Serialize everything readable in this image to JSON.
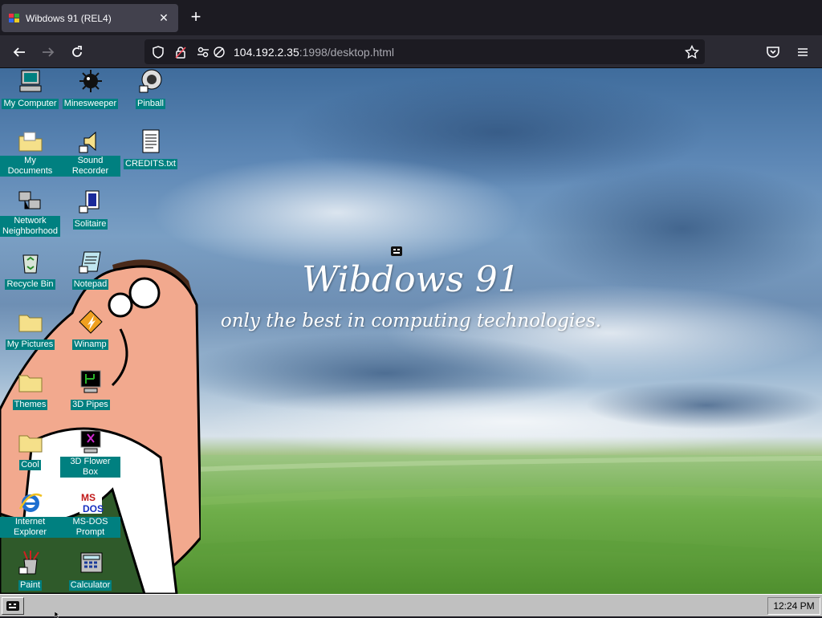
{
  "browser": {
    "tab_title": "Wibdows 91 (REL4)",
    "url_host": "104.192.2.35",
    "url_rest": ":1998/desktop.html"
  },
  "desktop": {
    "title": "Wibdows 91",
    "subtitle": "only the best in computing technologies.",
    "icons": [
      {
        "label": "My Computer",
        "icon": "computer-icon"
      },
      {
        "label": "Minesweeper",
        "icon": "minesweeper-icon"
      },
      {
        "label": "Pinball",
        "icon": "pinball-icon"
      },
      {
        "label": "My Documents",
        "icon": "documents-folder-icon"
      },
      {
        "label": "Sound Recorder",
        "icon": "sound-recorder-icon"
      },
      {
        "label": "CREDITS.txt",
        "icon": "text-file-icon"
      },
      {
        "label": "Network Neighborhood",
        "icon": "network-icon"
      },
      {
        "label": "Solitaire",
        "icon": "solitaire-icon"
      },
      {
        "label": "Recycle Bin",
        "icon": "recycle-bin-icon"
      },
      {
        "label": "Notepad",
        "icon": "notepad-icon"
      },
      {
        "label": "My Pictures",
        "icon": "folder-icon"
      },
      {
        "label": "Winamp",
        "icon": "winamp-icon"
      },
      {
        "label": "Themes",
        "icon": "folder-icon"
      },
      {
        "label": "3D Pipes",
        "icon": "screensaver-icon"
      },
      {
        "label": "Cool",
        "icon": "folder-icon"
      },
      {
        "label": "3D Flower Box",
        "icon": "screensaver-icon"
      },
      {
        "label": "Internet Explorer",
        "icon": "internet-explorer-icon"
      },
      {
        "label": "MS-DOS Prompt",
        "icon": "msdos-icon"
      },
      {
        "label": "Paint",
        "icon": "paint-icon"
      },
      {
        "label": "Calculator",
        "icon": "calculator-icon"
      }
    ]
  },
  "taskbar": {
    "clock": "12:24 PM"
  },
  "colors": {
    "icon_label_bg": "#008080",
    "taskbar": "#c0c0c0",
    "browser_chrome": "#2b2a33"
  }
}
